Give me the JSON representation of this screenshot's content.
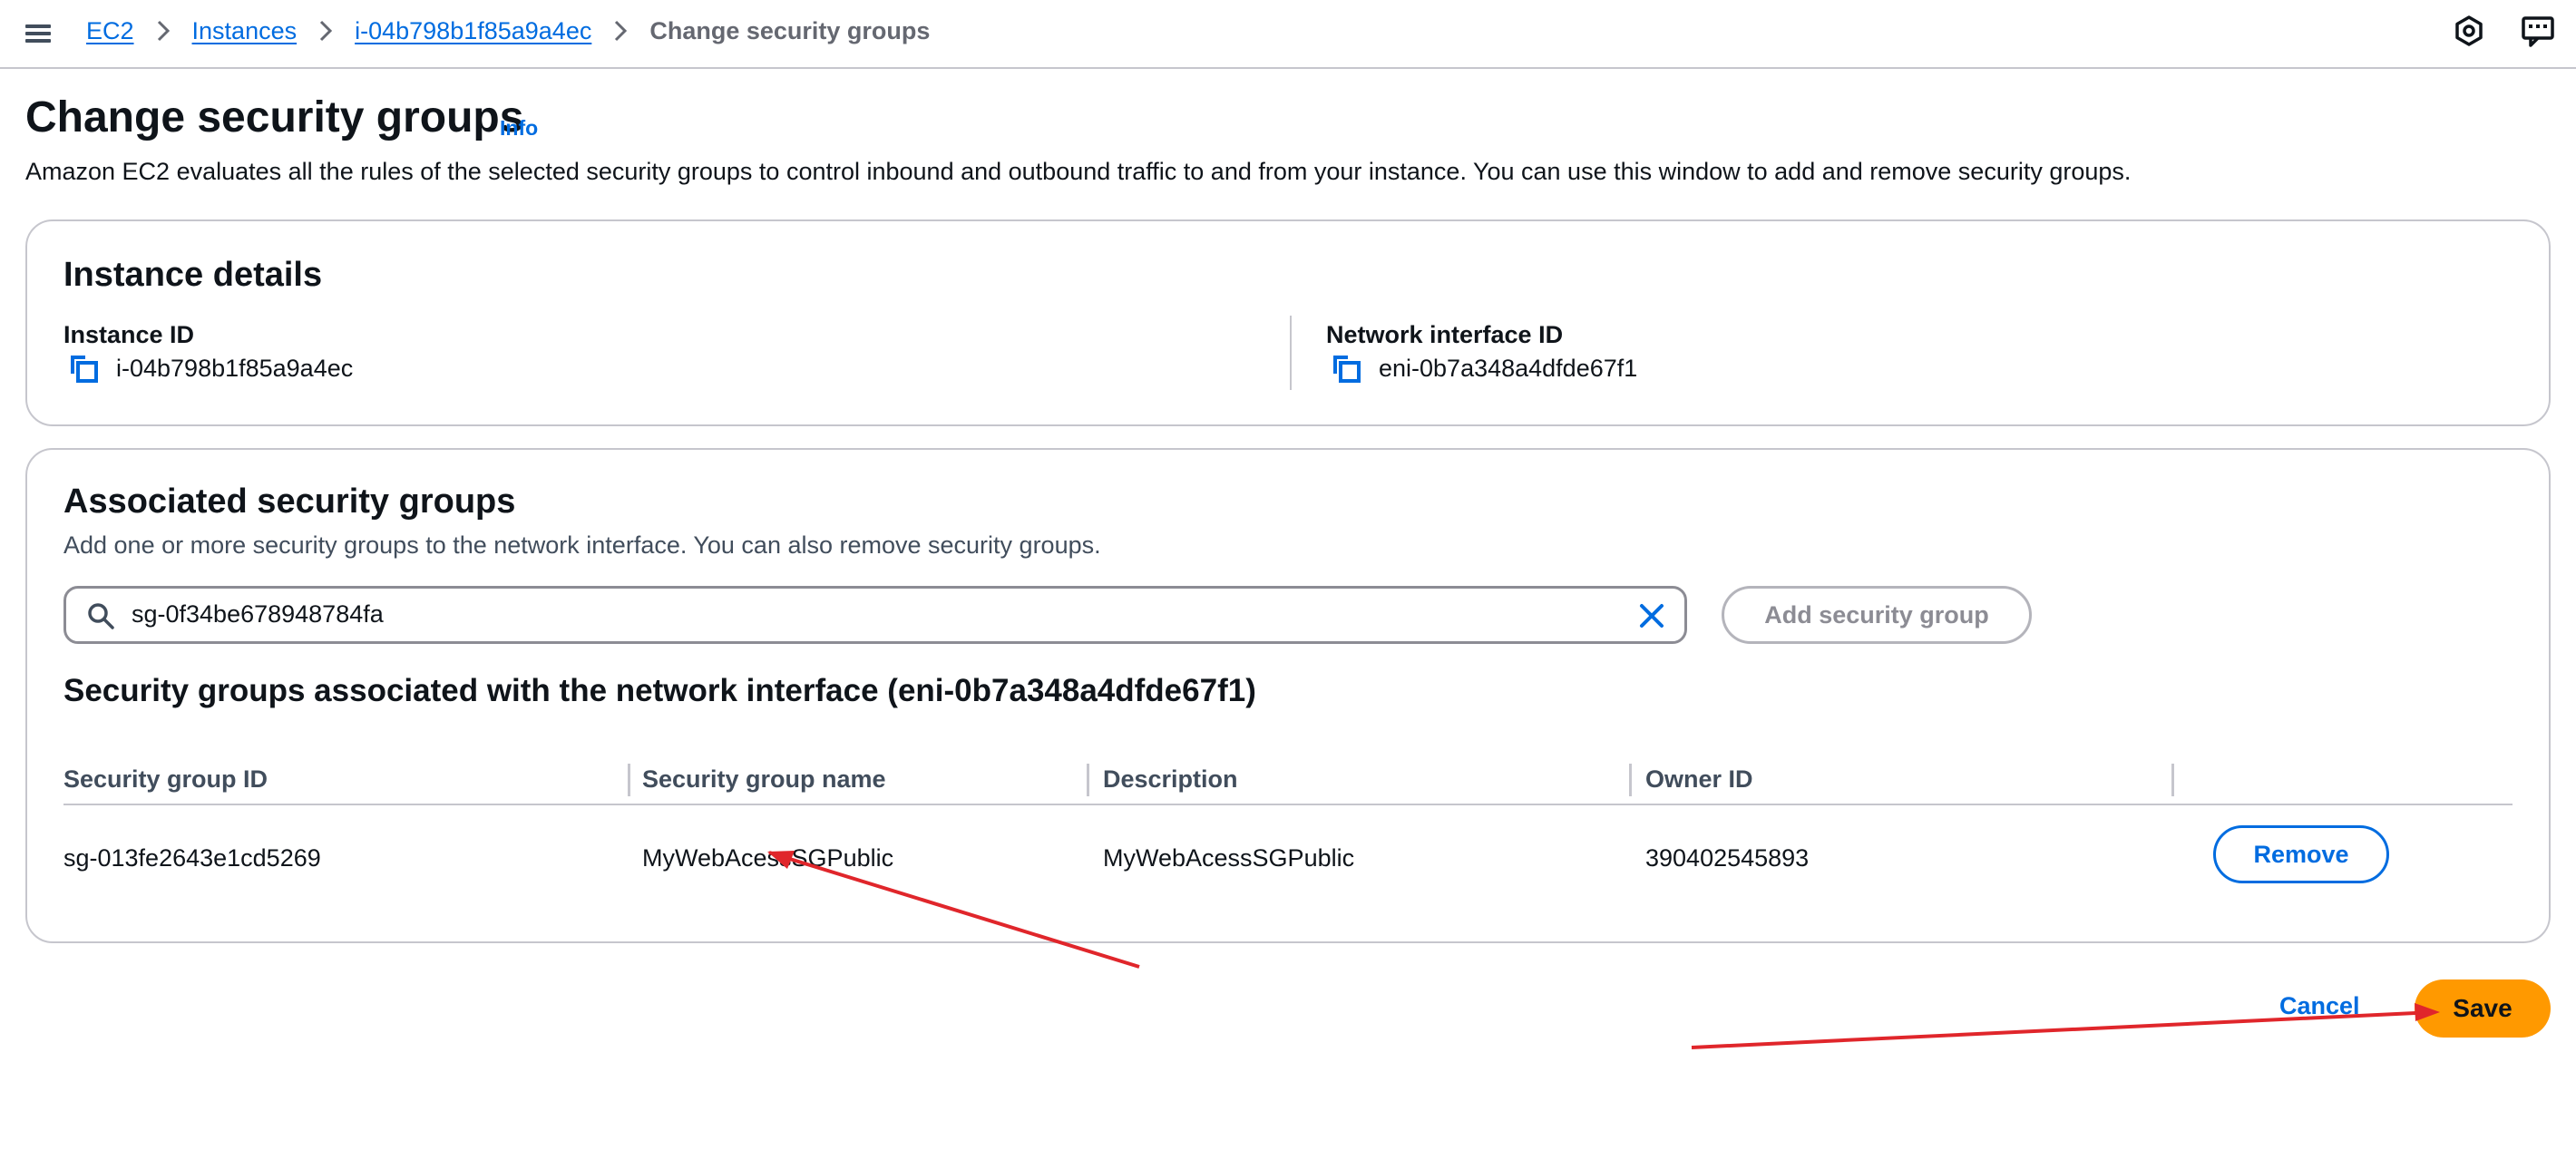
{
  "breadcrumb": {
    "items": [
      "EC2",
      "Instances",
      "i-04b798b1f85a9a4ec"
    ],
    "current": "Change security groups"
  },
  "icons": {
    "menu": "hamburger-menu-icon",
    "notifications": "settings-hex-icon",
    "feedback": "feedback-icon",
    "copy": "copy-icon",
    "search": "search-icon",
    "clear": "clear-x-icon",
    "separator": "chevron-right-icon"
  },
  "header": {
    "title": "Change security groups",
    "info": "Info",
    "description": "Amazon EC2 evaluates all the rules of the selected security groups to control inbound and outbound traffic to and from your instance. You can use this window to add and remove security groups."
  },
  "instance_details": {
    "title": "Instance details",
    "instance_id_label": "Instance ID",
    "instance_id": "i-04b798b1f85a9a4ec",
    "eni_label": "Network interface ID",
    "eni_id": "eni-0b7a348a4dfde67f1"
  },
  "associated": {
    "title": "Associated security groups",
    "description": "Add one or more security groups to the network interface. You can also remove security groups.",
    "search_value": "sg-0f34be678948784fa",
    "add_button": "Add security group",
    "table_title": "Security groups associated with the network interface (eni-0b7a348a4dfde67f1)",
    "columns": [
      "Security group ID",
      "Security group name",
      "Description",
      "Owner ID"
    ],
    "rows": [
      {
        "id": "sg-013fe2643e1cd5269",
        "name": "MyWebAcessSGPublic",
        "description": "MyWebAcessSGPublic",
        "owner": "390402545893",
        "action": "Remove"
      }
    ]
  },
  "footer": {
    "cancel": "Cancel",
    "save": "Save"
  },
  "colors": {
    "link": "#006ce0",
    "primary_button": "#ff9900",
    "annotation_arrow": "#e0262b",
    "border": "#c6c6cd"
  }
}
